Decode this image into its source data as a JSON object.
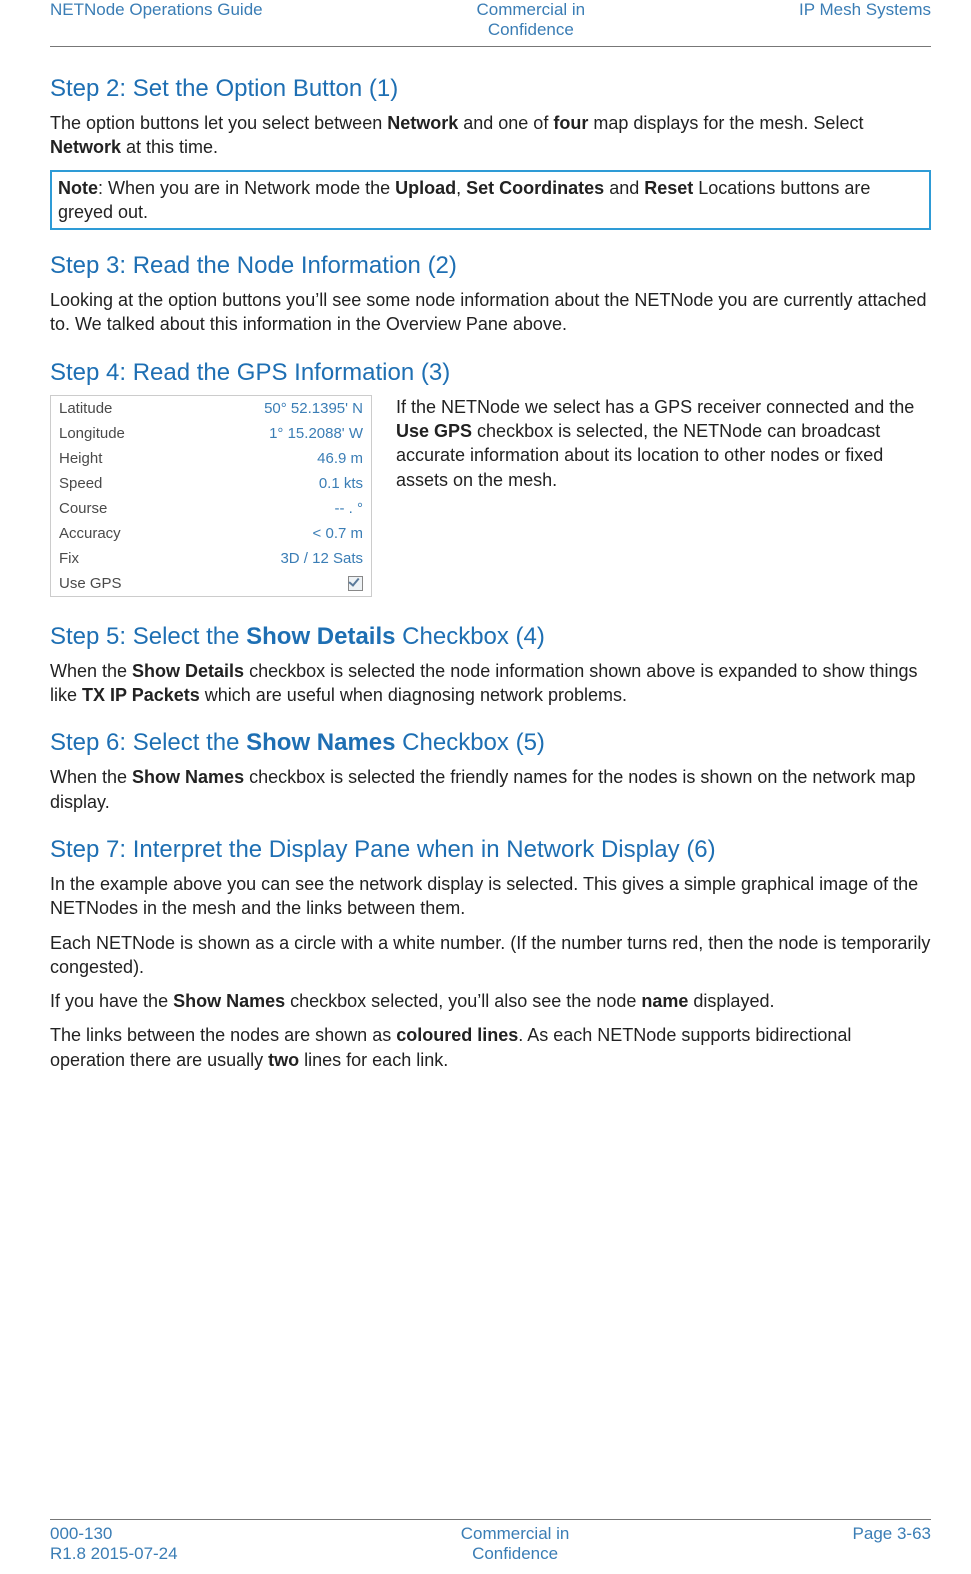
{
  "header": {
    "left": "NETNode Operations Guide",
    "center_line1": "Commercial in",
    "center_line2": "Confidence",
    "right": "IP Mesh Systems"
  },
  "step2": {
    "title_pre": "Step 2: Set the Option Button (1)",
    "para_1a": "The option buttons let you select between ",
    "para_1_b1": "Network",
    "para_1b": " and one of ",
    "para_1_b2": "four",
    "para_1c": " map displays for the mesh. Select ",
    "para_1_b3": "Network",
    "para_1d": " at this time.",
    "note_b": "Note",
    "note_a": ": When you are in Network mode the ",
    "note_b1": "Upload",
    "note_c": ", ",
    "note_b2": "Set Coordinates",
    "note_d": " and ",
    "note_b3": "Reset",
    "note_e": " Locations buttons are greyed out."
  },
  "step3": {
    "title": "Step 3: Read the Node Information (2)",
    "para": "Looking at the option buttons you’ll see some node information about the NETNode you are currently attached to. We talked about this information in the Overview Pane above."
  },
  "step4": {
    "title": "Step 4: Read the GPS Information (3)",
    "gps": {
      "rows": [
        {
          "label": "Latitude",
          "value": "50° 52.1395' N"
        },
        {
          "label": "Longitude",
          "value": "1° 15.2088' W"
        },
        {
          "label": "Height",
          "value": "46.9 m"
        },
        {
          "label": "Speed",
          "value": "0.1 kts"
        },
        {
          "label": "Course",
          "value": "-- . °"
        },
        {
          "label": "Accuracy",
          "value": "< 0.7 m"
        },
        {
          "label": "Fix",
          "value": "3D / 12 Sats"
        }
      ],
      "usegps_label": "Use GPS"
    },
    "side_a": "If the NETNode we select has a GPS receiver connected and the ",
    "side_b": "Use GPS",
    "side_c": " checkbox is selected, the NETNode can broadcast accurate information about its location to other nodes or fixed assets on the mesh."
  },
  "step5": {
    "title_a": "Step 5: Select the ",
    "title_b": "Show Details",
    "title_c": " Checkbox (4)",
    "para_a": "When the ",
    "para_b1": "Show Details",
    "para_b": " checkbox is selected the node information shown above is expanded to show things like ",
    "para_b2": "TX IP Packets",
    "para_c": " which are useful when diagnosing network problems."
  },
  "step6": {
    "title_a": "Step 6: Select the ",
    "title_b": "Show Names",
    "title_c": " Checkbox (5)",
    "para_a": "When the ",
    "para_b1": "Show Names",
    "para_b": " checkbox is selected the friendly names for the nodes is shown on the network map display."
  },
  "step7": {
    "title": "Step 7: Interpret the Display Pane when in Network Display (6)",
    "p1": "In the example above you can see the network display is selected. This gives a simple graphical image of the NETNodes in the mesh and the links between them.",
    "p2": "Each NETNode is shown as a circle with a white number. (If the number turns red, then the node is temporarily congested).",
    "p3a": "If you have the ",
    "p3b1": "Show Names",
    "p3b": " checkbox selected, you’ll also see the node ",
    "p3b2": "name",
    "p3c": " displayed.",
    "p4a": "The links between the nodes are shown as ",
    "p4b1": "coloured lines",
    "p4b": ". As each NETNode supports bidirectional operation there are usually ",
    "p4b2": "two",
    "p4c": " lines for each link."
  },
  "footer": {
    "left_line1": "000-130",
    "left_line2": "R1.8 2015-07-24",
    "center_line1": "Commercial in",
    "center_line2": "Confidence",
    "right": "Page 3-63"
  }
}
